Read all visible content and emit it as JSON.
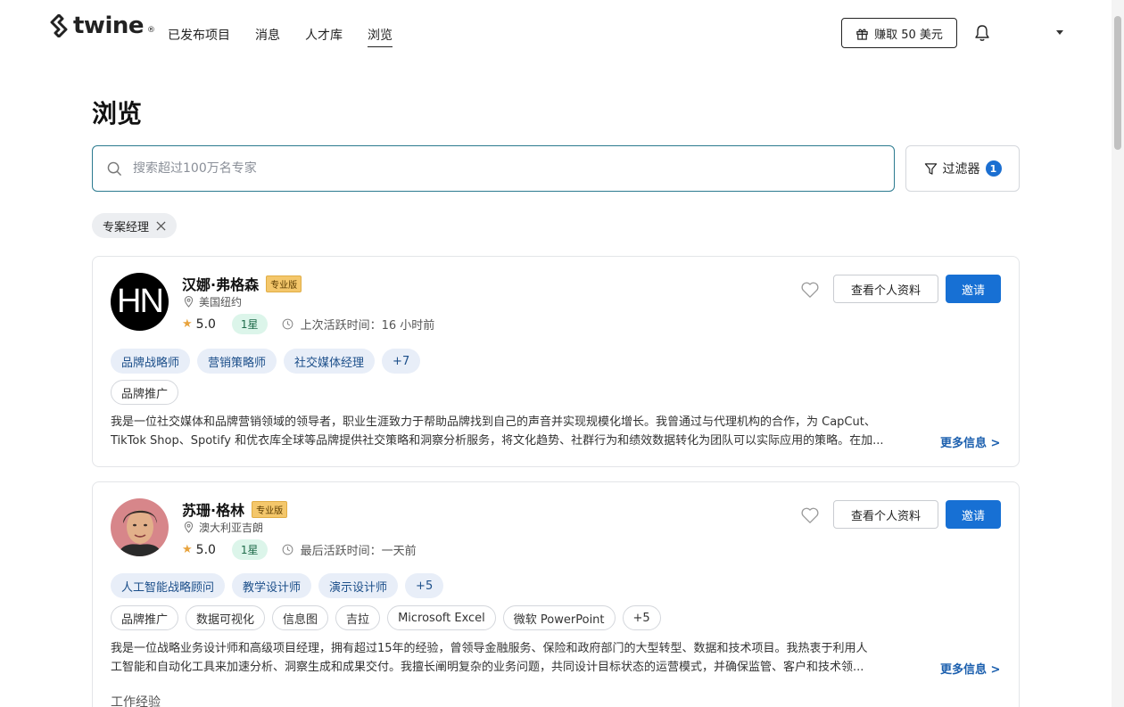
{
  "header": {
    "logo_text": "twine",
    "logo_reg": "®",
    "nav": [
      "已发布项目",
      "消息",
      "人才库",
      "浏览"
    ],
    "active_nav": "浏览",
    "earn_label": "赚取 50 美元"
  },
  "page": {
    "title": "浏览"
  },
  "search": {
    "placeholder": "搜索超过100万名专家",
    "value": "",
    "filter_label": "过滤器",
    "filter_count": "1"
  },
  "active_filters": [
    "专案经理"
  ],
  "colors": {
    "accent": "#1770d4",
    "pro_badge": "#f4c76b",
    "level_badge_bg": "#dcf5ea"
  },
  "profiles": [
    {
      "initials": "HN",
      "name": "汉娜·弗格森",
      "badge": "专业版",
      "location": "美国纽约",
      "rating": "5.0",
      "level": "1星",
      "activity": "上次活跃时间：16 小时前",
      "primary_tags": [
        "品牌战略师",
        "营销策略师",
        "社交媒体经理",
        "+7"
      ],
      "skill_tags": [
        "品牌推广"
      ],
      "bio_line1": "我是一位社交媒体和品牌营销领域的领导者，职业生涯致力于帮助品牌找到自己的声音并实现规模化增长。我曾通过与代理机构的合作，为 CapCut、",
      "bio_line2": "TikTok Shop、Spotify 和优衣库全球等品牌提供社交策略和洞察分析服务，将文化趋势、社群行为和绩效数据转化为团队可以实际应用的策略。在加...",
      "more": "更多信息 >",
      "view_profile": "查看个人资料",
      "invite": "邀请"
    },
    {
      "initials": "",
      "name": "苏珊·格林",
      "badge": "专业版",
      "location": "澳大利亚吉朗",
      "rating": "5.0",
      "level": "1星",
      "activity": "最后活跃时间：一天前",
      "primary_tags": [
        "人工智能战略顾问",
        "教学设计师",
        "演示设计师",
        "+5"
      ],
      "skill_tags": [
        "品牌推广",
        "数据可视化",
        "信息图",
        "吉拉",
        "Microsoft Excel",
        "微软 PowerPoint",
        "+5"
      ],
      "bio_line1": "我是一位战略业务设计师和高级项目经理，拥有超过15年的经验，曾领导金融服务、保险和政府部门的大型转型、数据和技术项目。我热衷于利用人",
      "bio_line2": "工智能和自动化工具来加速分析、洞察生成和成果交付。我擅长阐明复杂的业务问题，共同设计目标状态的运营模式，并确保监管、客户和技术领...",
      "more": "更多信息 >",
      "view_profile": "查看个人资料",
      "invite": "邀请",
      "section_label": "工作经验"
    }
  ]
}
